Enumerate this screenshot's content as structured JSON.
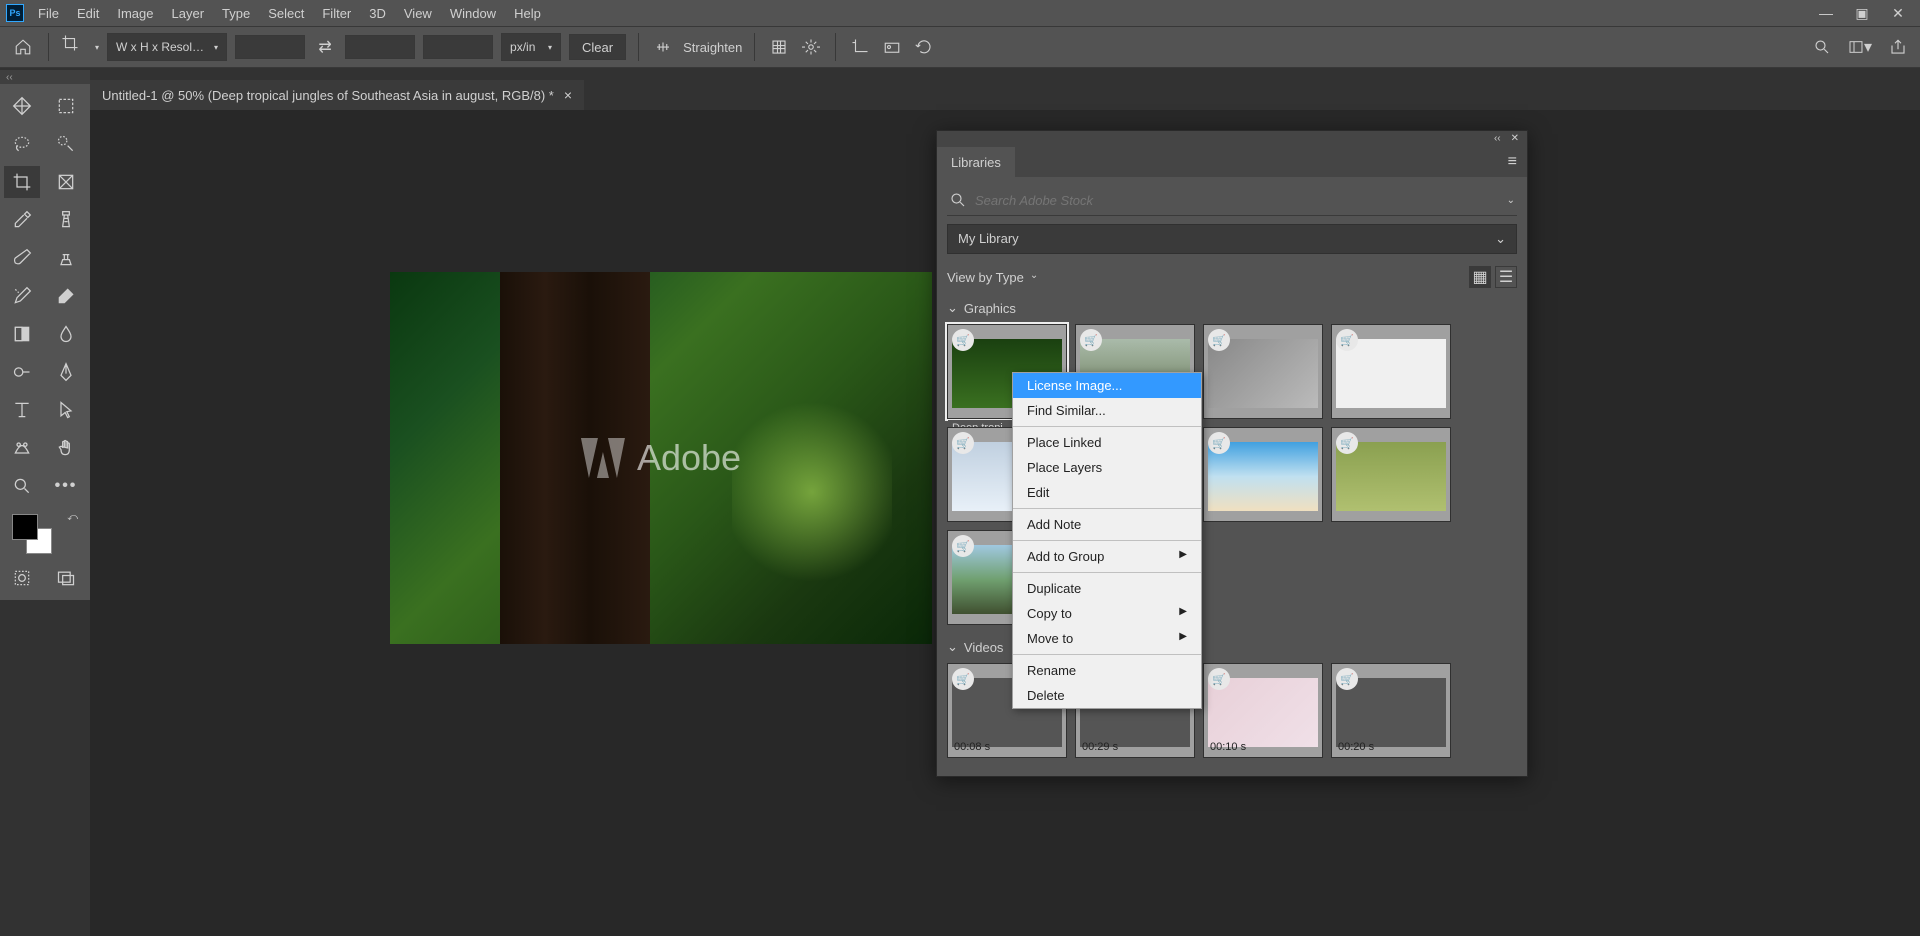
{
  "menu": [
    "File",
    "Edit",
    "Image",
    "Layer",
    "Type",
    "Select",
    "Filter",
    "3D",
    "View",
    "Window",
    "Help"
  ],
  "options": {
    "preset": "W x H x Resol…",
    "unit": "px/in",
    "clear": "Clear",
    "straighten": "Straighten"
  },
  "tab": {
    "title": "Untitled-1 @ 50% (Deep tropical jungles of Southeast Asia in august, RGB/8) *"
  },
  "watermark": "Adobe",
  "panel": {
    "tab": "Libraries",
    "search_placeholder": "Search Adobe Stock",
    "library": "My Library",
    "view_mode": "View by Type",
    "sections": {
      "graphics": "Graphics",
      "videos": "Videos"
    },
    "selected_label": "Deep tropi",
    "video_durations": [
      "00:08 s",
      "00:29 s",
      "00:10 s",
      "00:20 s"
    ]
  },
  "context_menu": [
    {
      "label": "License Image...",
      "hl": true
    },
    {
      "label": "Find Similar..."
    },
    {
      "sep": true
    },
    {
      "label": "Place Linked"
    },
    {
      "label": "Place Layers"
    },
    {
      "label": "Edit"
    },
    {
      "sep": true
    },
    {
      "label": "Add Note"
    },
    {
      "sep": true
    },
    {
      "label": "Add to Group",
      "arrow": true
    },
    {
      "sep": true
    },
    {
      "label": "Duplicate"
    },
    {
      "label": "Copy to",
      "arrow": true
    },
    {
      "label": "Move to",
      "arrow": true
    },
    {
      "sep": true
    },
    {
      "label": "Rename"
    },
    {
      "label": "Delete"
    }
  ]
}
